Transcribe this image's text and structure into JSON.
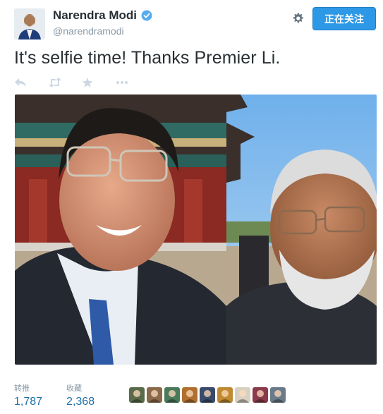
{
  "header": {
    "name": "Narendra Modi",
    "handle": "@narendramodi",
    "follow_label": "正在关注",
    "verified_icon": "verified-badge-icon",
    "settings_icon": "gear-icon"
  },
  "tweet": {
    "text": "It's selfie time! Thanks Premier Li."
  },
  "actions": [
    {
      "icon": "reply-icon"
    },
    {
      "icon": "retweet-icon"
    },
    {
      "icon": "favorite-star-icon"
    },
    {
      "icon": "more-icon"
    }
  ],
  "stats": {
    "retweets_label": "转推",
    "retweets_value": "1,787",
    "favorites_label": "收藏",
    "favorites_value": "2,368"
  },
  "colors": {
    "accent": "#2c98e6",
    "link": "#1d6fa8",
    "muted": "#8899a6",
    "sky": "#7fb6ea"
  },
  "favoriter_avatars": [
    {
      "color": "#5a6b4a"
    },
    {
      "color": "#8a6a4a"
    },
    {
      "color": "#4a7a5a"
    },
    {
      "color": "#b07030"
    },
    {
      "color": "#3a4a6a"
    },
    {
      "color": "#c08a30"
    },
    {
      "color": "#d8d0c0"
    },
    {
      "color": "#8a3a4a"
    },
    {
      "color": "#6a7a8a"
    }
  ]
}
